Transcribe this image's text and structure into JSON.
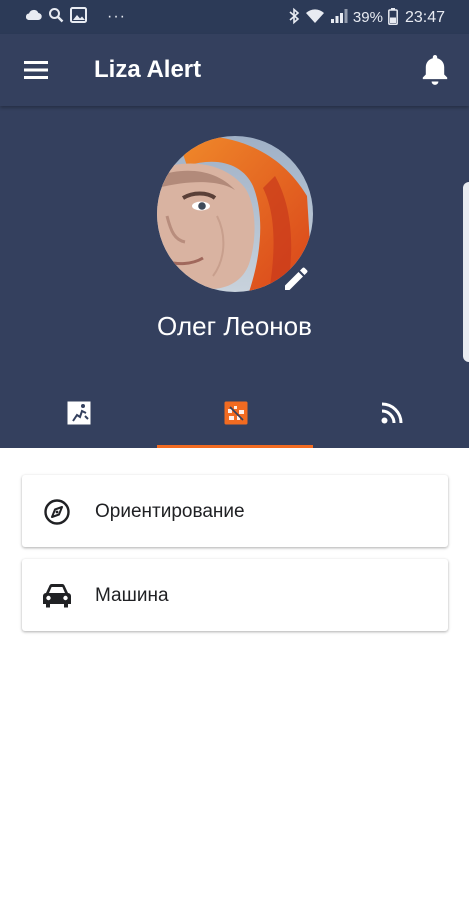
{
  "status_bar": {
    "battery": "39%",
    "time": "23:47",
    "overflow": "···",
    "icons": [
      "cloud-icon",
      "search-icon",
      "image-icon",
      "bluetooth-icon",
      "wifi-icon",
      "signal-icon",
      "battery-icon"
    ]
  },
  "app_bar": {
    "title": "Liza Alert",
    "icons": [
      "menu-icon",
      "bell-icon"
    ]
  },
  "profile": {
    "name": "Олег Леонов",
    "edit_icon": "pencil-icon"
  },
  "tabs": [
    {
      "icon": "exit-door-icon",
      "selected": false
    },
    {
      "icon": "grid-map-icon",
      "selected": true
    },
    {
      "icon": "rss-feed-icon",
      "selected": false
    }
  ],
  "list": {
    "items": [
      {
        "label": "Ориентирование",
        "icon": "compass-icon"
      },
      {
        "label": "Машина",
        "icon": "car-icon"
      }
    ]
  },
  "colors": {
    "status_bar_bg": "#2c3a57",
    "header_bg": "#34405e",
    "accent": "#f26b21",
    "text_on_dark": "#ffffff",
    "text_dark": "#202124"
  }
}
